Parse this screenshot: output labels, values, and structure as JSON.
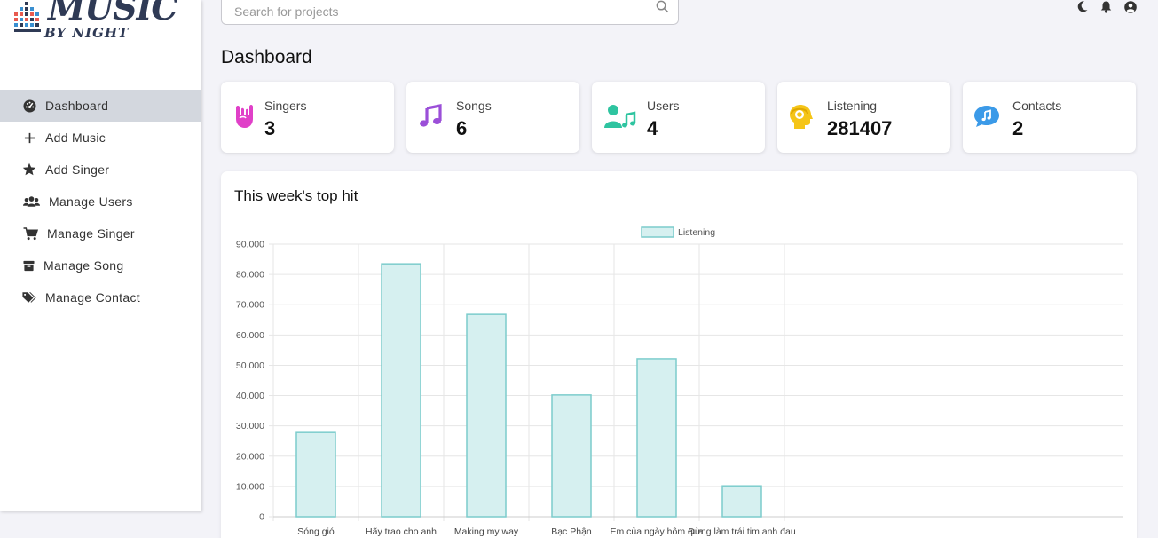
{
  "app": {
    "logo_text": "MUSIC",
    "logo_subtext": "BY NIGHT"
  },
  "sidebar": {
    "items": [
      {
        "label": "Dashboard",
        "icon": "dashboard-icon",
        "active": true
      },
      {
        "label": "Add Music",
        "icon": "plus-icon",
        "active": false
      },
      {
        "label": "Add Singer",
        "icon": "star-icon",
        "active": false
      },
      {
        "label": "Manage Users",
        "icon": "users-icon",
        "active": false
      },
      {
        "label": "Manage Singer",
        "icon": "cart-icon",
        "active": false
      },
      {
        "label": "Manage Song",
        "icon": "box-icon",
        "active": false
      },
      {
        "label": "Manage Contact",
        "icon": "tags-icon",
        "active": false
      }
    ]
  },
  "search": {
    "placeholder": "Search for projects",
    "value": ""
  },
  "topbar": {
    "icons": [
      "moon-icon",
      "bell-icon",
      "user-circle-icon"
    ]
  },
  "page": {
    "title": "Dashboard"
  },
  "stats": [
    {
      "label": "Singers",
      "value": "3",
      "icon": "rock-hand-icon",
      "color": "#e040c8"
    },
    {
      "label": "Songs",
      "value": "6",
      "icon": "music-note-icon",
      "color": "#9b4fd8"
    },
    {
      "label": "Users",
      "value": "4",
      "icon": "user-music-icon",
      "color": "#2ec4a0"
    },
    {
      "label": "Listening",
      "value": "281407",
      "icon": "head-headphones-icon",
      "color": "#f5c518"
    },
    {
      "label": "Contacts",
      "value": "2",
      "icon": "chat-music-icon",
      "color": "#3b9ae8"
    }
  ],
  "panel": {
    "title": "This week's top hit"
  },
  "chart_data": {
    "type": "bar",
    "categories": [
      "Sóng gió",
      "Hãy trao cho anh",
      "Making my way",
      "Bạc Phận",
      "Em của ngày hôm qua",
      "Đừng làm trái tim anh đau"
    ],
    "series": [
      {
        "name": "Listening",
        "values": [
          27800,
          83500,
          66800,
          40200,
          52200,
          10200
        ]
      }
    ],
    "ylim": [
      0,
      90000
    ],
    "yticks": [
      "0",
      "10.000",
      "20.000",
      "30.000",
      "40.000",
      "50.000",
      "60.000",
      "70.000",
      "80.000",
      "90.000"
    ],
    "grid": true,
    "legend": "top-center",
    "bar_fill": "#d6f0f0",
    "bar_stroke": "#7ccccc"
  }
}
